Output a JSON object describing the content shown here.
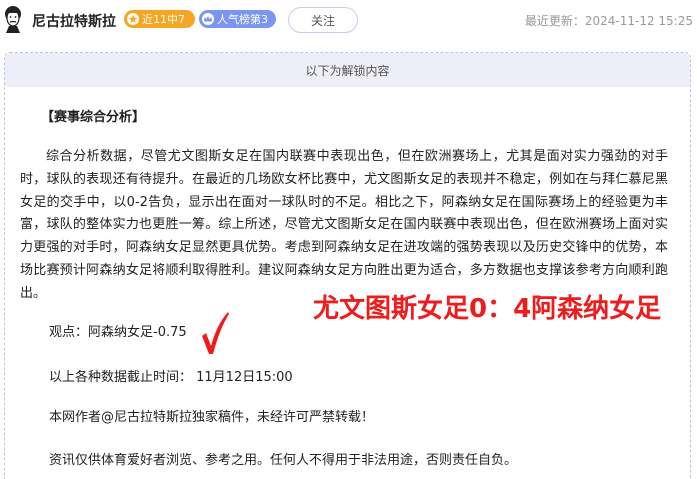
{
  "header": {
    "author_name": "尼古拉特斯拉",
    "badge_streak": "近11中7",
    "badge_popularity": "人气榜第3",
    "follow_label": "关注",
    "last_update": "最近更新：2024-11-12 15:25",
    "avatar_icon": "tesla-avatar-icon",
    "streak_icon": "star-icon",
    "popularity_icon": "crown-icon"
  },
  "unlock": {
    "banner_text": "以下为解锁内容"
  },
  "article": {
    "section_title": "【赛事综合分析】",
    "paragraph": "综合分析数据，尽管尤文图斯女足在国内联赛中表现出色，但在欧洲赛场上，尤其是面对实力强劲的对手时，球队的表现还有待提升。在最近的几场欧女杯比赛中，尤文图斯女足的表现并不稳定，例如在与拜仁慕尼黑女足的交手中，以0-2告负，显示出在面对一球队时的不足。相比之下，阿森纳女足在国际赛场上的经验更为丰富，球队的整体实力也更胜一筹。综上所述，尽管尤文图斯女足在国内联赛中表现出色，但在欧洲赛场上面对实力更强的对手时，阿森纳女足显然更具优势。考虑到阿森纳女足在进攻端的强势表现以及历史交锋中的优势，本场比赛预计阿森纳女足将顺利取得胜利。建议阿森纳女足方向胜出更为适合，多方数据也支撑该参考方向顺利跑出。",
    "viewpoint": "观点：阿森纳女足-0.75",
    "cutoff": "以上各种数据截止时间：  11月12日15:00",
    "copyright": "本网作者@尼古拉特斯拉独家稿件，未经许可严禁转载！",
    "disclaimer": "资讯仅供体育爱好者浏览、参考之用。任何人不得用于非法用途，否则责任自负。"
  },
  "overlay": {
    "score_text": "尤文图斯女足0：4阿森纳女足",
    "check_icon": "red-checkmark-icon"
  },
  "colors": {
    "streak_badge": "#f5a623",
    "popularity_badge": "#7b96f0",
    "overlay_red": "#ee1c1c",
    "banner_bg": "#eeeef8"
  }
}
